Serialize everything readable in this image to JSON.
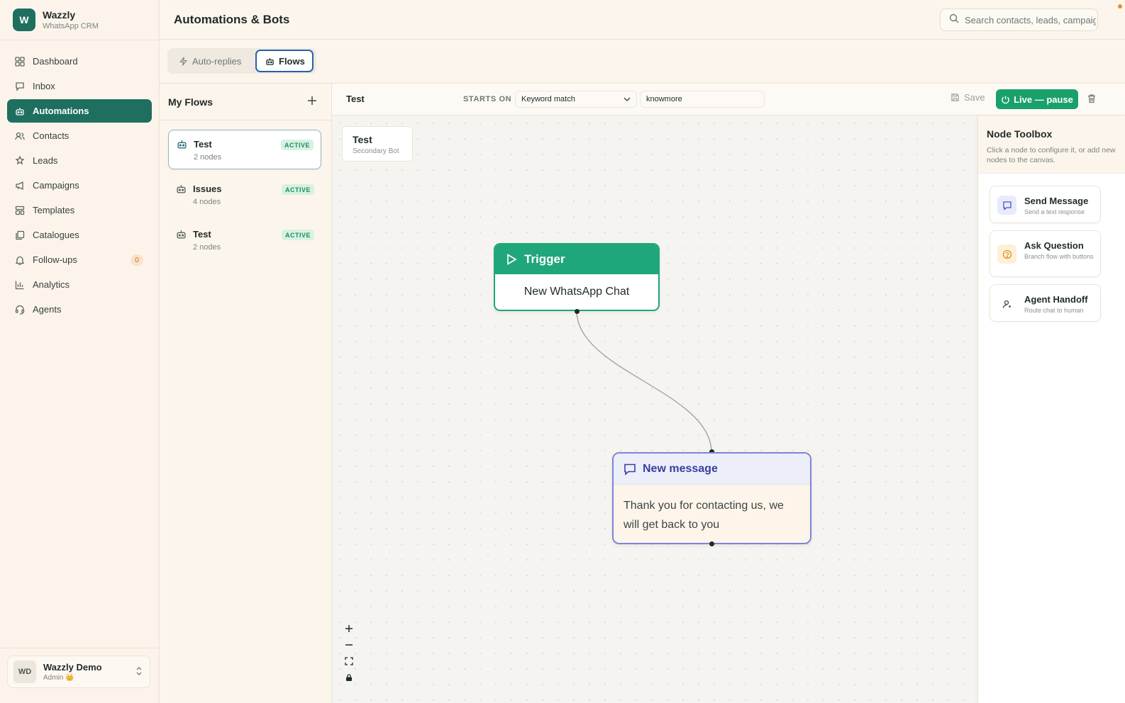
{
  "brand": {
    "logo": "W",
    "name": "Wazzly",
    "subtitle": "WhatsApp CRM"
  },
  "nav": [
    {
      "label": "Dashboard",
      "icon": "dashboard-icon"
    },
    {
      "label": "Inbox",
      "icon": "inbox-icon"
    },
    {
      "label": "Automations",
      "icon": "bot-icon",
      "active": true
    },
    {
      "label": "Contacts",
      "icon": "contacts-icon"
    },
    {
      "label": "Leads",
      "icon": "leads-icon"
    },
    {
      "label": "Campaigns",
      "icon": "megaphone-icon"
    },
    {
      "label": "Templates",
      "icon": "templates-icon"
    },
    {
      "label": "Catalogues",
      "icon": "catalogue-icon"
    },
    {
      "label": "Follow-ups",
      "icon": "bell-icon",
      "badge": "0"
    },
    {
      "label": "Analytics",
      "icon": "analytics-icon"
    },
    {
      "label": "Agents",
      "icon": "headset-icon"
    }
  ],
  "user": {
    "initials": "WD",
    "name": "Wazzly Demo",
    "role": "Admin 👑"
  },
  "header": {
    "title": "Automations & Bots",
    "search_placeholder": "Search contacts, leads, campaigns"
  },
  "tabs": {
    "auto_replies": "Auto-replies",
    "flows": "Flows"
  },
  "flows_panel": {
    "title": "My Flows",
    "items": [
      {
        "name": "Test",
        "nodes": "2 nodes",
        "status": "ACTIVE",
        "selected": true
      },
      {
        "name": "Issues",
        "nodes": "4 nodes",
        "status": "ACTIVE"
      },
      {
        "name": "Test",
        "nodes": "2 nodes",
        "status": "ACTIVE"
      }
    ]
  },
  "toolbar": {
    "flow_name": "Test",
    "starts_on_label": "STARTS ON",
    "trigger_type": "Keyword match",
    "keyword": "knowmore",
    "save_label": "Save",
    "live_label": "Live — pause"
  },
  "canvas": {
    "flow_label": {
      "name": "Test",
      "subtitle": "Secondary Bot"
    },
    "trigger_node": {
      "title": "Trigger",
      "body": "New WhatsApp Chat"
    },
    "message_node": {
      "title": "New message",
      "body": "Thank you for contacting us, we will get back to you"
    }
  },
  "toolbox": {
    "title": "Node Toolbox",
    "description": "Click a node to configure it, or add new nodes to the canvas.",
    "items": [
      {
        "name": "Send Message",
        "desc": "Send a text response",
        "icon": "message-icon",
        "color": "#e8ebfb"
      },
      {
        "name": "Ask Question",
        "desc": "Branch flow with buttons",
        "icon": "question-icon",
        "color": "#fdf0d6"
      },
      {
        "name": "Agent Handoff",
        "desc": "Route chat to human",
        "icon": "agent-icon",
        "color": "#ffffff"
      }
    ]
  },
  "colors": {
    "brand": "#1e6f60",
    "live": "#1aa06b",
    "trigger": "#1fa67a",
    "message": "#7c85d8",
    "active_badge": "#1f8a57"
  }
}
